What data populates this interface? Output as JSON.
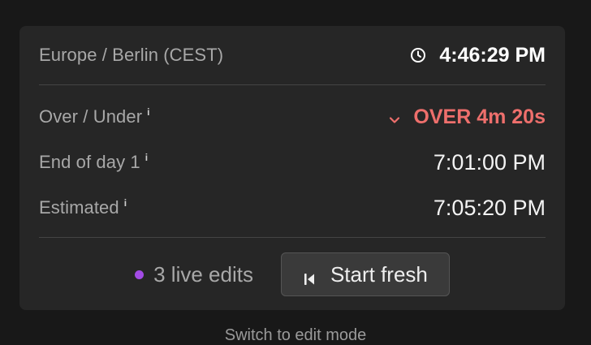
{
  "timezone": {
    "label": "Europe / Berlin (CEST)",
    "current_time": "4:46:29 PM",
    "icon": "clock-icon"
  },
  "metrics": {
    "over_under": {
      "label": "Over / Under",
      "info": "i",
      "value": "OVER 4m 20s",
      "icon": "chevron-down-icon",
      "color": "#ee6f6c"
    },
    "end_of_day": {
      "label": "End of day 1",
      "info": "i",
      "value": "7:01:00 PM"
    },
    "estimated": {
      "label": "Estimated",
      "info": "i",
      "value": "7:05:20 PM"
    }
  },
  "footer": {
    "live_edits": "3 live edits",
    "live_dot_color": "#a24be5",
    "start_fresh_label": "Start fresh",
    "start_fresh_icon": "skip-back-icon"
  },
  "below_text": "Switch to edit mode"
}
